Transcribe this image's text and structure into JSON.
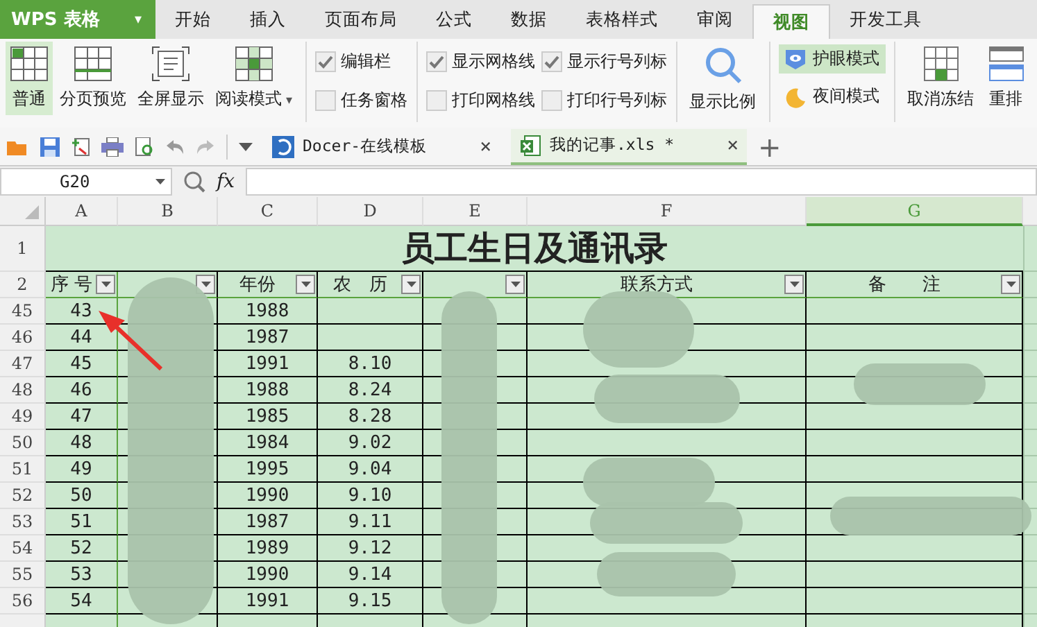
{
  "app": {
    "logo": "WPS 表格",
    "menu_caret": "▾"
  },
  "tabs": [
    {
      "label": "开始",
      "selected": false
    },
    {
      "label": "插入",
      "selected": false
    },
    {
      "label": "页面布局",
      "selected": false
    },
    {
      "label": "公式",
      "selected": false
    },
    {
      "label": "数据",
      "selected": false
    },
    {
      "label": "表格样式",
      "selected": false
    },
    {
      "label": "审阅",
      "selected": false
    },
    {
      "label": "视图",
      "selected": true
    },
    {
      "label": "开发工具",
      "selected": false
    }
  ],
  "ribbon": {
    "view_buttons": [
      {
        "label": "普通",
        "selected": true,
        "kind": "normal"
      },
      {
        "label": "分页预览",
        "selected": false,
        "kind": "pagebreak"
      },
      {
        "label": "全屏显示",
        "selected": false,
        "kind": "fullscreen"
      },
      {
        "label": "阅读模式",
        "selected": false,
        "kind": "reading",
        "caret": "▾"
      }
    ],
    "checkboxes": [
      {
        "label": "编辑栏",
        "checked": true
      },
      {
        "label": "任务窗格",
        "checked": false
      },
      {
        "label": "显示网格线",
        "checked": true
      },
      {
        "label": "打印网格线",
        "checked": false
      },
      {
        "label": "显示行号列标",
        "checked": true
      },
      {
        "label": "打印行号列标",
        "checked": false
      }
    ],
    "zoom_button": "显示比例",
    "modes": [
      {
        "label": "护眼模式",
        "selected": true,
        "kind": "eye"
      },
      {
        "label": "夜间模式",
        "selected": false,
        "kind": "night"
      }
    ],
    "freeze_buttons": [
      {
        "label": "取消冻结",
        "kind": "freeze"
      },
      {
        "label": "重排",
        "kind": "arrange"
      }
    ]
  },
  "doc_tabs": [
    {
      "label": "Docer-在线模板",
      "selected": false,
      "kind": "docer",
      "close": "×"
    },
    {
      "label": "我的记事.xls *",
      "selected": true,
      "kind": "sheet",
      "close": "×"
    }
  ],
  "new_tab": "+",
  "formula_bar": {
    "name_box": "G20",
    "fx": "fx"
  },
  "sheet": {
    "columns": [
      {
        "label": "A",
        "selected": false
      },
      {
        "label": "B",
        "selected": false
      },
      {
        "label": "C",
        "selected": false
      },
      {
        "label": "D",
        "selected": false
      },
      {
        "label": "E",
        "selected": false
      },
      {
        "label": "F",
        "selected": false
      },
      {
        "label": "G",
        "selected": true
      }
    ],
    "title_row": "1",
    "title": "员工生日及通讯录",
    "header_row": "2",
    "headers": {
      "A": "序 号",
      "C": "年份",
      "D": "农　历",
      "F": "联系方式",
      "G": "备　　注"
    },
    "rows": [
      {
        "row": "45",
        "A": "43",
        "C": "1988"
      },
      {
        "row": "46",
        "A": "44",
        "C": "1987"
      },
      {
        "row": "47",
        "A": "45",
        "C": "1991",
        "D": "8.10"
      },
      {
        "row": "48",
        "A": "46",
        "C": "1988",
        "D": "8.24"
      },
      {
        "row": "49",
        "A": "47",
        "C": "1985",
        "D": "8.28"
      },
      {
        "row": "50",
        "A": "48",
        "C": "1984",
        "D": "9.02"
      },
      {
        "row": "51",
        "A": "49",
        "C": "1995",
        "D": "9.04"
      },
      {
        "row": "52",
        "A": "50",
        "C": "1990",
        "D": "9.10"
      },
      {
        "row": "53",
        "A": "51",
        "C": "1987",
        "D": "9.11"
      },
      {
        "row": "54",
        "A": "52",
        "C": "1989",
        "D": "9.12"
      },
      {
        "row": "55",
        "A": "53",
        "C": "1990",
        "D": "9.14"
      },
      {
        "row": "56",
        "A": "54",
        "C": "1991",
        "D": "9.15"
      }
    ]
  }
}
